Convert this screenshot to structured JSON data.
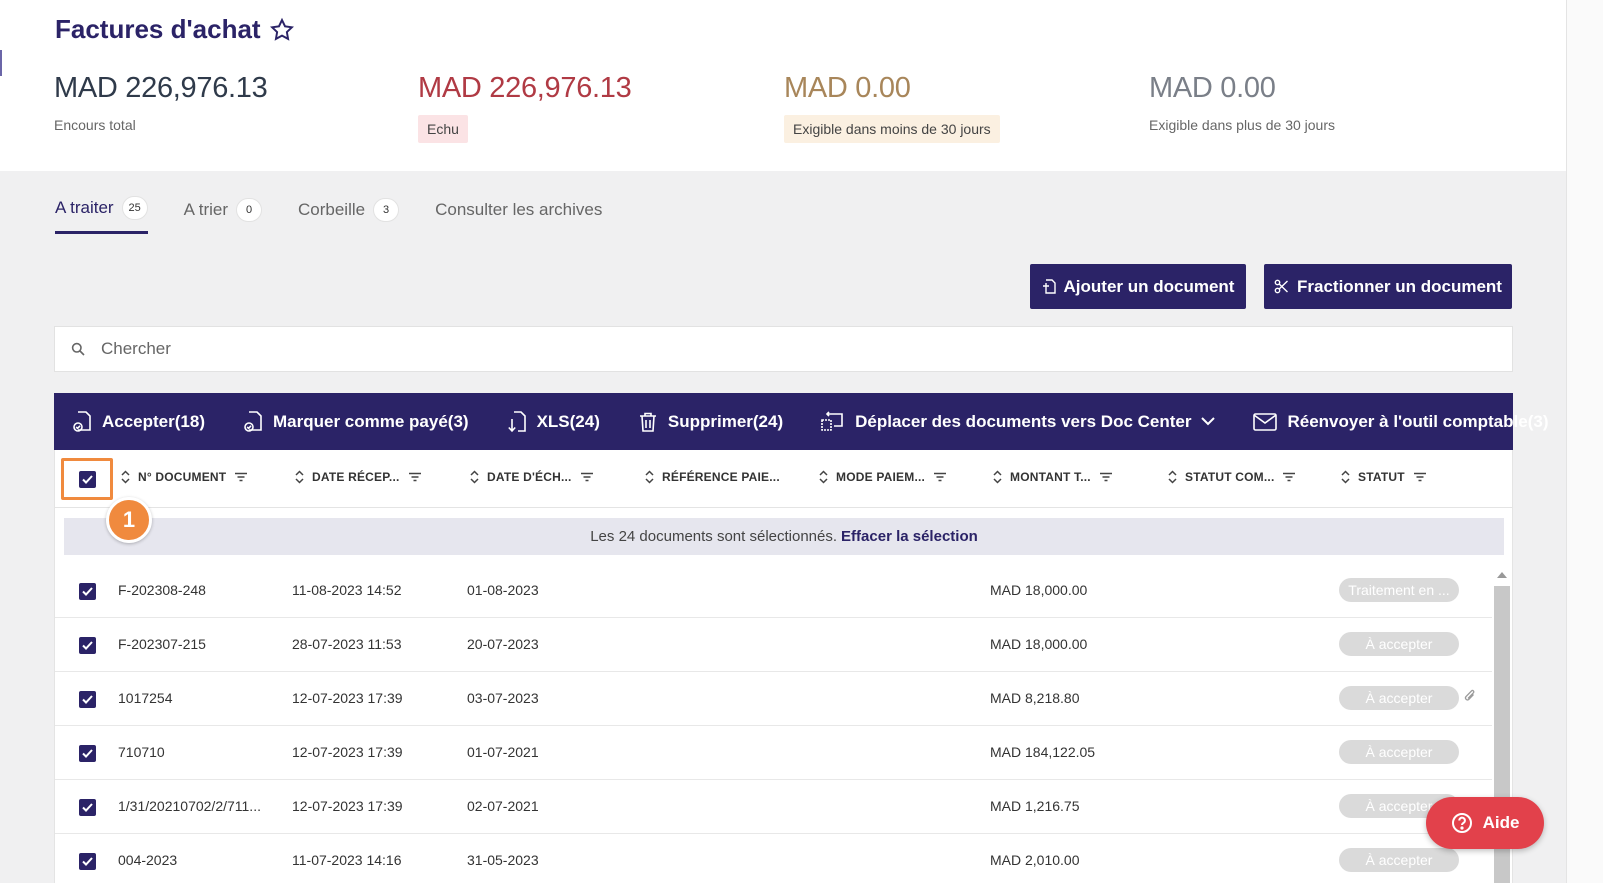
{
  "header": {
    "title": "Factures d'achat",
    "kpis": [
      {
        "amount": "MAD 226,976.13",
        "label": "Encours total",
        "color": "#2f3a4a"
      },
      {
        "amount": "MAD 226,976.13",
        "label": "Echu",
        "color": "#b03a44",
        "badge_bg": "#fbe3e5"
      },
      {
        "amount": "MAD 0.00",
        "label": "Exigible dans moins de 30 jours",
        "color": "#a8865a",
        "badge_bg": "#fbf0e1"
      },
      {
        "amount": "MAD 0.00",
        "label": "Exigible dans plus de 30 jours",
        "color": "#7a7f88"
      }
    ]
  },
  "tabs": [
    {
      "label": "A traiter",
      "count": "25"
    },
    {
      "label": "A trier",
      "count": "0"
    },
    {
      "label": "Corbeille",
      "count": "3"
    },
    {
      "label": "Consulter les archives"
    }
  ],
  "buttons": {
    "add": "Ajouter un document",
    "split": "Fractionner un document"
  },
  "search": {
    "placeholder": "Chercher"
  },
  "actions": [
    "Accepter(18)",
    "Marquer comme payé(3)",
    "XLS(24)",
    "Supprimer(24)",
    "Déplacer des documents vers Doc Center",
    "Réenvoyer à l'outil comptable(3)"
  ],
  "columns": [
    "N° DOCUMENT",
    "DATE RÉCEP...",
    "DATE D'ÉCH...",
    "RÉFÉRENCE PAIE...",
    "MODE PAIEM...",
    "MONTANT T...",
    "STATUT COM...",
    "STATUT"
  ],
  "step_marker": "1",
  "selection": {
    "text": "Les 24 documents sont sélectionnés.",
    "clear": "Effacer la sélection"
  },
  "rows": [
    {
      "doc": "F-202308-248",
      "received": "11-08-2023 14:52",
      "due": "01-08-2023",
      "amount": "MAD 18,000.00",
      "status": "Traitement en ..."
    },
    {
      "doc": "F-202307-215",
      "received": "28-07-2023 11:53",
      "due": "20-07-2023",
      "amount": "MAD 18,000.00",
      "status": "À accepter"
    },
    {
      "doc": "1017254",
      "received": "12-07-2023 17:39",
      "due": "03-07-2023",
      "amount": "MAD 8,218.80",
      "status": "À accepter"
    },
    {
      "doc": "710710",
      "received": "12-07-2023 17:39",
      "due": "01-07-2021",
      "amount": "MAD 184,122.05",
      "status": "À accepter"
    },
    {
      "doc": "1/31/20210702/2/711...",
      "received": "12-07-2023 17:39",
      "due": "02-07-2021",
      "amount": "MAD 1,216.75",
      "status": "À accepter"
    },
    {
      "doc": "004-2023",
      "received": "11-07-2023 14:16",
      "due": "31-05-2023",
      "amount": "MAD 2,010.00",
      "status": "À accepter"
    }
  ],
  "help": {
    "label": "Aide"
  },
  "colors": {
    "primary": "#2b2367",
    "accent": "#f08a3e",
    "help": "#e2414b"
  }
}
